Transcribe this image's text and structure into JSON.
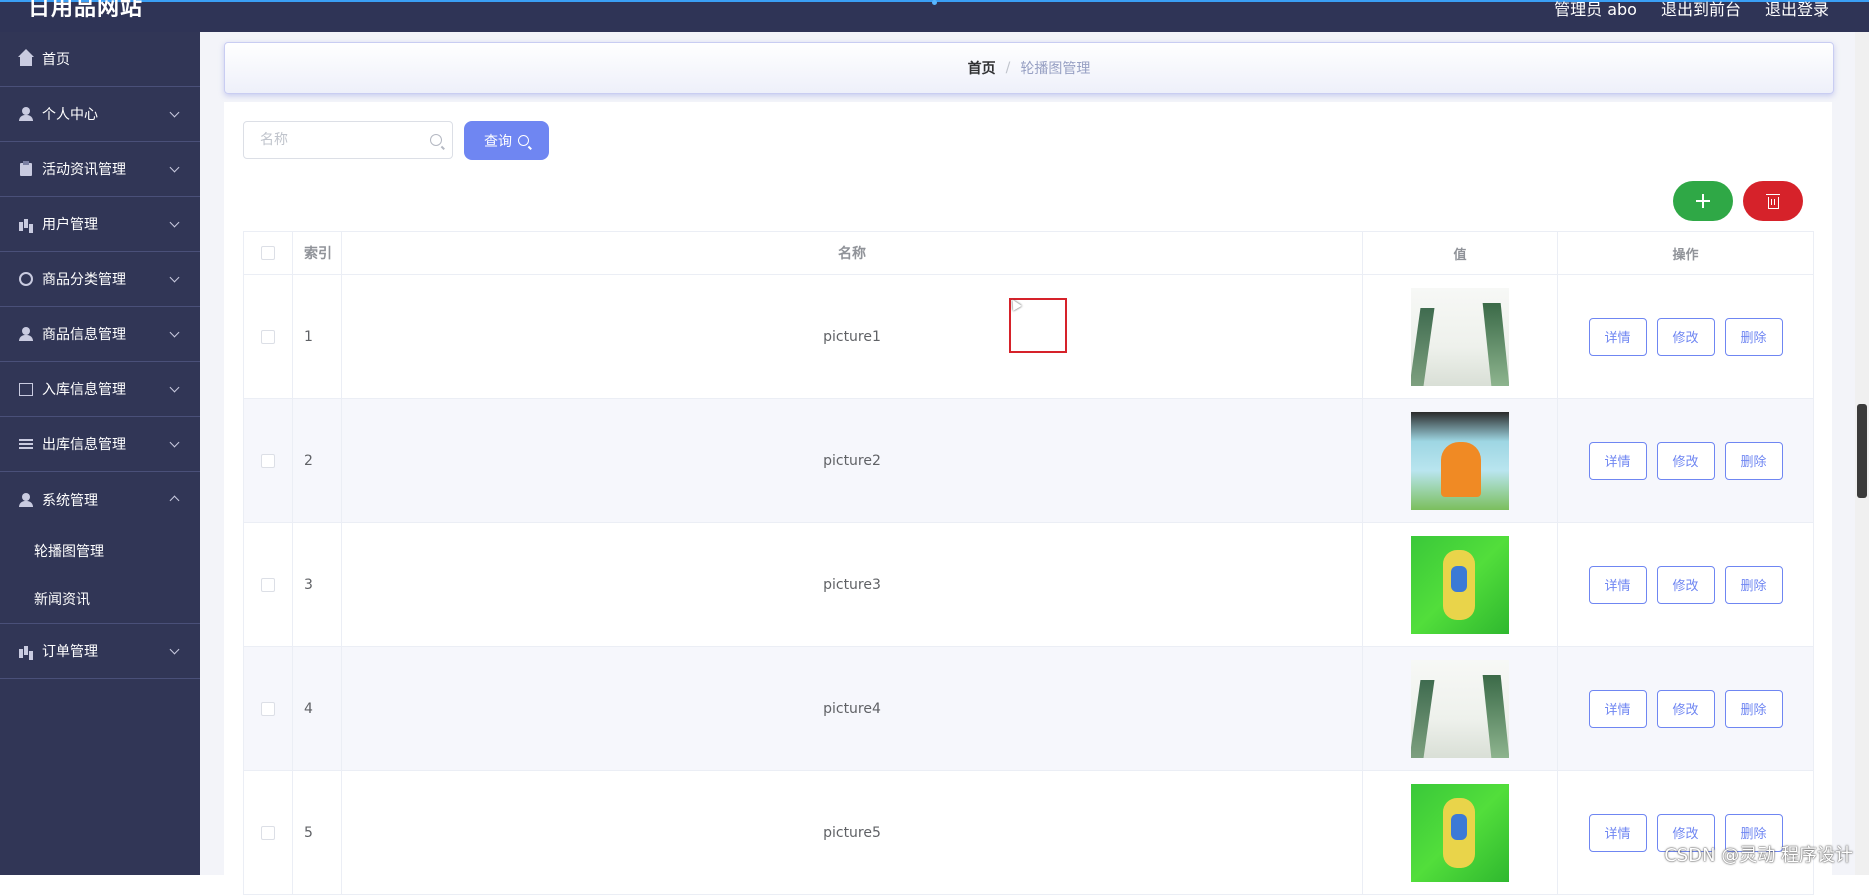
{
  "header": {
    "site_title": "日用品网站",
    "links": [
      "管理员 abo",
      "退出到前台",
      "退出登录"
    ]
  },
  "sidebar": {
    "items": [
      {
        "label": "首页",
        "icon": "home-icon"
      },
      {
        "label": "个人中心",
        "icon": "user-icon",
        "expandable": true
      },
      {
        "label": "活动资讯管理",
        "icon": "clipboard-icon",
        "expandable": true
      },
      {
        "label": "用户管理",
        "icon": "bars-icon",
        "expandable": true
      },
      {
        "label": "商品分类管理",
        "icon": "ring-icon",
        "expandable": true
      },
      {
        "label": "商品信息管理",
        "icon": "user-icon",
        "expandable": true
      },
      {
        "label": "入库信息管理",
        "icon": "chart-icon",
        "expandable": true
      },
      {
        "label": "出库信息管理",
        "icon": "list-icon",
        "expandable": true
      },
      {
        "label": "系统管理",
        "icon": "user-icon",
        "expanded": true
      },
      {
        "label": "订单管理",
        "icon": "bars-icon",
        "expandable": true
      }
    ],
    "system_submenu": [
      "轮播图管理",
      "新闻资讯"
    ]
  },
  "breadcrumb": {
    "home": "首页",
    "separator": "/",
    "current": "轮播图管理"
  },
  "search": {
    "placeholder": "名称",
    "button_label": "查询"
  },
  "table": {
    "headers": [
      "索引",
      "名称",
      "值",
      "操作"
    ],
    "actions": [
      "详情",
      "修改",
      "删除"
    ],
    "rows": [
      {
        "index": "1",
        "name": "picture1",
        "thumb": "a"
      },
      {
        "index": "2",
        "name": "picture2",
        "thumb": "b"
      },
      {
        "index": "3",
        "name": "picture3",
        "thumb": "c"
      },
      {
        "index": "4",
        "name": "picture4",
        "thumb": "a"
      },
      {
        "index": "5",
        "name": "picture5",
        "thumb": "c"
      }
    ]
  },
  "watermark": "CSDN @灵动 程序设计",
  "colors": {
    "sidebar_bg": "#313656",
    "primary": "#6f86f2",
    "add": "#2fa846",
    "delete": "#d6222a"
  }
}
